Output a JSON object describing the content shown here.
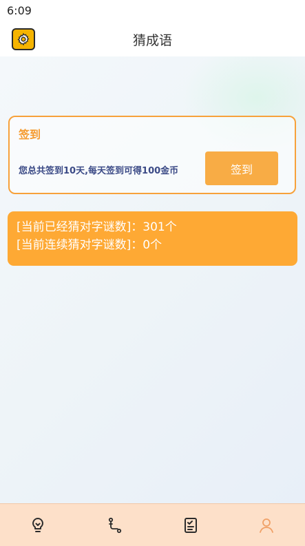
{
  "status_bar": {
    "time": "6:09"
  },
  "header": {
    "title": "猜成语",
    "settings_icon": "gear-icon"
  },
  "signin": {
    "title": "签到",
    "description": "您总共签到10天,每天签到可得100金币",
    "button_label": "签到"
  },
  "stats": {
    "solved_line": "[当前已经猜对字谜数]：301个",
    "streak_line": "[当前连续猜对字谜数]：0个"
  },
  "bottom_nav": {
    "items": [
      {
        "icon": "lightbulb-icon"
      },
      {
        "icon": "path-icon"
      },
      {
        "icon": "checklist-icon"
      },
      {
        "icon": "user-icon"
      }
    ]
  },
  "colors": {
    "accent": "#f8ac45",
    "stats_bg": "#fea934",
    "desc_text": "#3b4a86",
    "nav_bg": "#fde0c9"
  }
}
